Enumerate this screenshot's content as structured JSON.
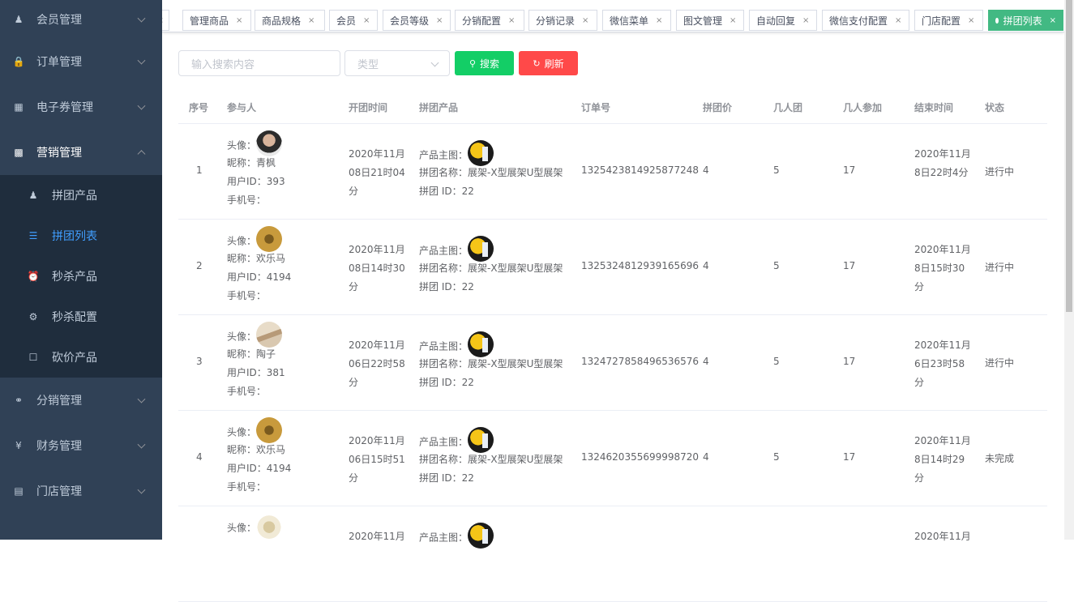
{
  "sidebar": {
    "items": [
      {
        "label": "会员管理",
        "icon": "user-icon"
      },
      {
        "label": "订单管理",
        "icon": "lock-icon"
      },
      {
        "label": "电子券管理",
        "icon": "coupon-icon"
      },
      {
        "label": "营销管理",
        "icon": "chart-icon"
      },
      {
        "label": "分销管理",
        "icon": "share-icon"
      },
      {
        "label": "财务管理",
        "icon": "yen-icon"
      },
      {
        "label": "门店管理",
        "icon": "store-icon"
      }
    ],
    "sub_items": [
      {
        "label": "拼团产品",
        "icon": "users-icon"
      },
      {
        "label": "拼团列表",
        "icon": "list-icon"
      },
      {
        "label": "秒杀产品",
        "icon": "alarm-icon"
      },
      {
        "label": "秒杀配置",
        "icon": "gear-icon"
      },
      {
        "label": "砍价产品",
        "icon": "calendar-icon"
      }
    ]
  },
  "tabs": [
    "管理商品",
    "商品规格",
    "会员",
    "会员等级",
    "分销配置",
    "分销记录",
    "微信菜单",
    "图文管理",
    "自动回复",
    "微信支付配置",
    "门店配置",
    "拼团列表"
  ],
  "toolbar": {
    "search_placeholder": "输入搜索内容",
    "type_placeholder": "类型",
    "search_label": "搜索",
    "refresh_label": "刷新"
  },
  "table": {
    "headers": [
      "序号",
      "参与人",
      "开团时间",
      "拼团产品",
      "订单号",
      "拼团价",
      "几人团",
      "几人参加",
      "结束时间",
      "状态"
    ],
    "labels": {
      "avatar": "头像：",
      "nickname": "昵称：",
      "user_id": "用户ID：",
      "phone": "手机号：",
      "product_img": "产品主图：",
      "product_name": "拼团名称：",
      "group_id": "拼团 ID："
    },
    "rows": [
      {
        "no": "1",
        "nickname": "青枫",
        "user_id": "393",
        "start_a": "2020年11月",
        "start_b": "08日21时04",
        "start_c": "分",
        "product_name": "展架-X型展架U型展架",
        "group_id": "22",
        "order_no": "1325423814925877248",
        "price": "4",
        "size": "5",
        "joined": "17",
        "end_a": "2020年11月",
        "end_b": "8日22时4分",
        "end_c": "",
        "status": "进行中"
      },
      {
        "no": "2",
        "nickname": "欢乐马",
        "user_id": "4194",
        "start_a": "2020年11月",
        "start_b": "08日14时30",
        "start_c": "分",
        "product_name": "展架-X型展架U型展架",
        "group_id": "22",
        "order_no": "1325324812939165696",
        "price": "4",
        "size": "5",
        "joined": "17",
        "end_a": "2020年11月",
        "end_b": "8日15时30",
        "end_c": "分",
        "status": "进行中"
      },
      {
        "no": "3",
        "nickname": "陶子",
        "user_id": "381",
        "start_a": "2020年11月",
        "start_b": "06日22时58",
        "start_c": "分",
        "product_name": "展架-X型展架U型展架",
        "group_id": "22",
        "order_no": "1324727858496536576",
        "price": "4",
        "size": "5",
        "joined": "17",
        "end_a": "2020年11月",
        "end_b": "6日23时58",
        "end_c": "分",
        "status": "进行中"
      },
      {
        "no": "4",
        "nickname": "欢乐马",
        "user_id": "4194",
        "start_a": "2020年11月",
        "start_b": "06日15时51",
        "start_c": "分",
        "product_name": "展架-X型展架U型展架",
        "group_id": "22",
        "order_no": "1324620355699998720",
        "price": "4",
        "size": "5",
        "joined": "17",
        "end_a": "2020年11月",
        "end_b": "8日14时29",
        "end_c": "分",
        "status": "未完成"
      },
      {
        "no": "",
        "nickname": "",
        "user_id": "",
        "start_a": "2020年11月",
        "start_b": "",
        "start_c": "",
        "product_name": "",
        "group_id": "",
        "order_no": "",
        "price": "",
        "size": "",
        "joined": "",
        "end_a": "2020年11月",
        "end_b": "",
        "end_c": "",
        "status": ""
      }
    ]
  },
  "colors": {
    "sidebar_bg": "#304156",
    "submenu_bg": "#1f2d3d",
    "active_blue": "#409eff",
    "tab_active": "#42b983",
    "search_btn": "#13ce66",
    "refresh_btn": "#ff4949"
  }
}
